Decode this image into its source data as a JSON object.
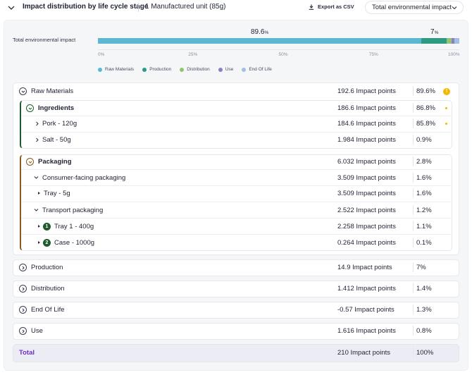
{
  "header": {
    "title": "Impact distribution by life cycle stage",
    "unit": "1 Manufactured unit (85g)",
    "export_label": "Export as CSV",
    "select_value": "Total environmental impact"
  },
  "chart_data": {
    "type": "bar",
    "orientation": "horizontal-stacked",
    "row_label": "Total environmental impact",
    "series": [
      {
        "name": "Raw Materials",
        "value": 89.6,
        "color": "#5bb8d0"
      },
      {
        "name": "Production",
        "value": 7,
        "color": "#2e9a82"
      },
      {
        "name": "Distribution",
        "value": 1.4,
        "color": "#93c472"
      },
      {
        "name": "Use",
        "value": 0.8,
        "color": "#8a80c4"
      },
      {
        "name": "End Of Life",
        "value": 1.3,
        "color": "#a6bde3"
      }
    ],
    "segment_labels": [
      {
        "value": "89.6",
        "unit": "%"
      },
      {
        "value": "7",
        "unit": "%"
      }
    ],
    "ticks": [
      "0%",
      "25%",
      "50%",
      "75%",
      "100%"
    ],
    "xlim": [
      0,
      100
    ]
  },
  "table": {
    "rows": [
      {
        "label": "Raw Materials",
        "value": "192.6 Impact points",
        "pct": "89.6%",
        "warn": "!"
      },
      {
        "label": "Ingredients",
        "value": "186.6 Impact points",
        "pct": "86.8%"
      },
      {
        "label": "Pork - 120g",
        "value": "184.6 Impact points",
        "pct": "85.8%"
      },
      {
        "label": "Salt - 50g",
        "value": "1.984 Impact points",
        "pct": "0.9%"
      },
      {
        "label": "Packaging",
        "value": "6.032 Impact points",
        "pct": "2.8%"
      },
      {
        "label": "Consumer-facing packaging",
        "value": "3.509 Impact points",
        "pct": "1.6%"
      },
      {
        "label": "Tray - 5g",
        "value": "3.509 Impact points",
        "pct": "1.6%"
      },
      {
        "label": "Transport packaging",
        "value": "2.522 Impact points",
        "pct": "1.2%"
      },
      {
        "label": "Tray 1 - 400g",
        "value": "2.258 Impact points",
        "pct": "1.1%",
        "badge": "1"
      },
      {
        "label": "Case - 1000g",
        "value": "0.264 Impact points",
        "pct": "0.1%",
        "badge": "2"
      },
      {
        "label": "Production",
        "value": "14.9 Impact points",
        "pct": "7%"
      },
      {
        "label": "Distribution",
        "value": "1.412 Impact points",
        "pct": "1.4%"
      },
      {
        "label": "End Of Life",
        "value": "-0.57 Impact points",
        "pct": "1.3%"
      },
      {
        "label": "Use",
        "value": "1.616 Impact points",
        "pct": "0.8%"
      }
    ],
    "total": {
      "label": "Total",
      "value": "210 Impact points",
      "pct": "100%"
    }
  },
  "colors": {
    "ingredients_border": "#1f5b2c",
    "packaging_border": "#8a5a1e",
    "total_label": "#6b2fc8",
    "warn": "#f5b700"
  }
}
